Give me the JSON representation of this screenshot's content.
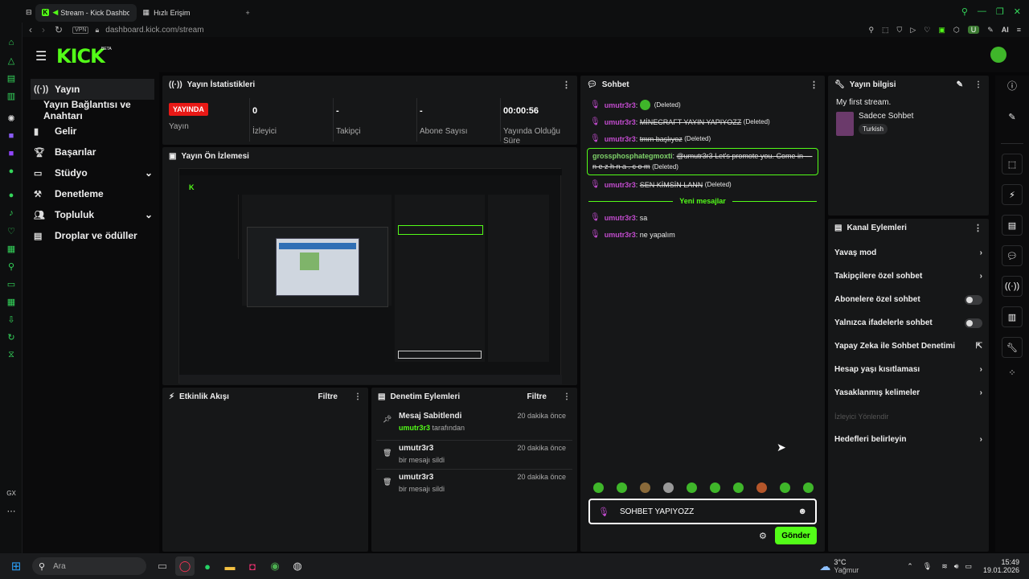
{
  "browser": {
    "tabs": [
      {
        "label": "Stream - Kick Dashboard"
      },
      {
        "label": "Hızlı Erişim"
      }
    ],
    "address": "dashboard.kick.com/stream",
    "vpn": "VPN",
    "ai_label": "AI",
    "profile_initial": "U"
  },
  "app": {
    "logo": "KICK",
    "logo_badge": "BETA"
  },
  "sidebar": {
    "items": [
      {
        "label": "Yayın",
        "icon": "broadcast-icon"
      },
      {
        "label": "Yayın Bağlantısı ve Anahtarı",
        "icon": ""
      },
      {
        "label": "Gelir",
        "icon": "chart-icon"
      },
      {
        "label": "Başarılar",
        "icon": "trophy-icon"
      },
      {
        "label": "Stüdyo",
        "icon": "studio-icon"
      },
      {
        "label": "Denetleme",
        "icon": "hammer-icon"
      },
      {
        "label": "Topluluk",
        "icon": "community-icon"
      },
      {
        "label": "Droplar ve ödüller",
        "icon": "drops-icon"
      }
    ]
  },
  "stats": {
    "title": "Yayın İstatistikleri",
    "live_badge": "YAYINDA",
    "live_label": "Yayın",
    "viewers_value": "0",
    "viewers_label": "İzleyici",
    "followers_value": "-",
    "followers_label": "Takipçi",
    "subs_value": "-",
    "subs_label": "Abone Sayısı",
    "uptime_value": "00:00:56",
    "uptime_label": "Yayında Olduğu Süre"
  },
  "preview": {
    "title": "Yayın Ön İzlemesi"
  },
  "activity": {
    "title": "Etkinlik Akışı",
    "filter": "Filtre"
  },
  "moderation": {
    "title": "Denetim Eylemleri",
    "filter": "Filtre",
    "items": [
      {
        "title": "Mesaj Sabitlendi",
        "user": "umutr3r3",
        "sub": "tarafından",
        "time": "20 dakika önce"
      },
      {
        "title": "umutr3r3",
        "user": "",
        "sub": "bir mesajı sildi",
        "time": "20 dakika önce"
      },
      {
        "title": "umutr3r3",
        "user": "",
        "sub": "bir mesajı sildi",
        "time": "20 dakika önce"
      }
    ]
  },
  "chat": {
    "title": "Sohbet",
    "messages": [
      {
        "user": "umutr3r3",
        "text": "",
        "deleted": "(Deleted)"
      },
      {
        "user": "umutr3r3",
        "text": "MİNECRAFT YAYIN YAPIYOZZ",
        "deleted": "(Deleted)"
      },
      {
        "user": "umutr3r3",
        "text": "tmm başlıyoz",
        "deleted": "(Deleted)"
      },
      {
        "user": "grossphosphategmoxti",
        "text": "@umutr3r3 Let's promote you. Come in — n e z h n a . c o m",
        "deleted": "(Deleted)"
      },
      {
        "user": "umutr3r3",
        "text": "SEN KİMSİN LANN",
        "deleted": "(Deleted)"
      },
      {
        "user": "umutr3r3",
        "text": "sa",
        "deleted": ""
      },
      {
        "user": "umutr3r3",
        "text": "ne yapalım",
        "deleted": ""
      }
    ],
    "new_messages": "Yeni mesajlar",
    "input_value": "SOHBET YAPIYOZZ",
    "send": "Gönder"
  },
  "stream_info": {
    "title": "Yayın bilgisi",
    "stream_title": "My first stream.",
    "category": "Sadece Sohbet",
    "language": "Turkish"
  },
  "channel_actions": {
    "title": "Kanal Eylemleri",
    "items": [
      {
        "label": "Yavaş mod",
        "type": "arrow"
      },
      {
        "label": "Takipçilere özel sohbet",
        "type": "arrow"
      },
      {
        "label": "Abonelere özel sohbet",
        "type": "toggle"
      },
      {
        "label": "Yalnızca ifadelerle sohbet",
        "type": "toggle"
      },
      {
        "label": "Yapay Zeka ile Sohbet Denetimi",
        "type": "external"
      },
      {
        "label": "Hesap yaşı kısıtlaması",
        "type": "arrow"
      },
      {
        "label": "Yasaklanmış kelimeler",
        "type": "arrow"
      },
      {
        "label": "İzleyici Yönlendir",
        "type": "disabled"
      },
      {
        "label": "Hedefleri belirleyin",
        "type": "arrow"
      }
    ]
  },
  "taskbar": {
    "search_placeholder": "Ara",
    "weather_temp": "3°C",
    "weather_desc": "Yağmur",
    "time": "15:49",
    "date": "19.01.2026",
    "gx": "GX"
  }
}
